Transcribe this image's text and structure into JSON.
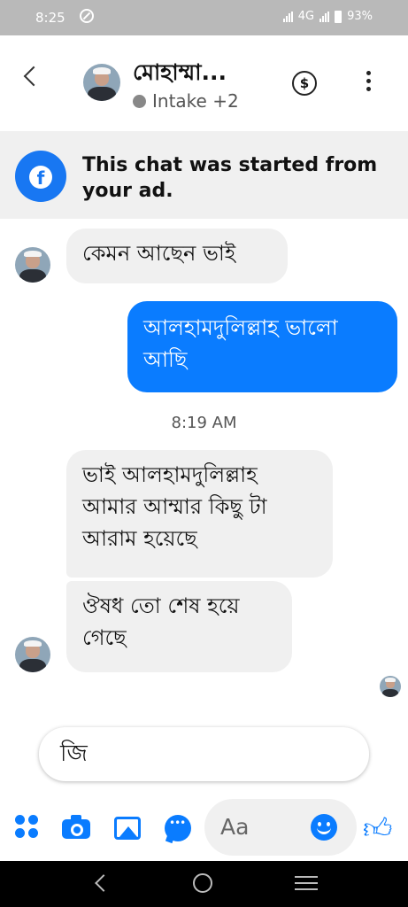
{
  "status_bar": {
    "time": "8:25",
    "network": "4G",
    "battery": "93%"
  },
  "header": {
    "contact_name": "মোহাম্মা...",
    "subtitle": "Intake +2"
  },
  "ad_banner": {
    "text": "This chat was started from your ad."
  },
  "messages": [
    {
      "direction": "incoming",
      "text": "কেমন আছেন ভাই"
    },
    {
      "direction": "outgoing",
      "text": "আলহামদুলিল্লাহ ভালো আছি"
    },
    {
      "direction": "incoming",
      "text": "ভাই আলহামদুলিল্লাহ আমার আম্মার কিছু টা আরাম হয়েছে"
    },
    {
      "direction": "incoming",
      "text": "ঔষধ তো শেষ হয়ে গেছে"
    }
  ],
  "timestamp": "8:19 AM",
  "compose_text": "জি",
  "toolbar": {
    "input_placeholder": "Aa"
  },
  "icons": {
    "header": [
      "back-icon",
      "avatar",
      "dollar-icon",
      "more-icon"
    ],
    "toolbar": [
      "apps-grid-icon",
      "camera-icon",
      "gallery-icon",
      "chat-bubble-icon",
      "emoji-icon",
      "thumbs-up-icon"
    ],
    "navigation": [
      "nav-back-icon",
      "nav-home-icon",
      "nav-recent-icon"
    ]
  },
  "colors": {
    "accent": "#0a7cff",
    "facebook_blue": "#1877f2",
    "incoming_bubble": "#f0f0f0"
  }
}
